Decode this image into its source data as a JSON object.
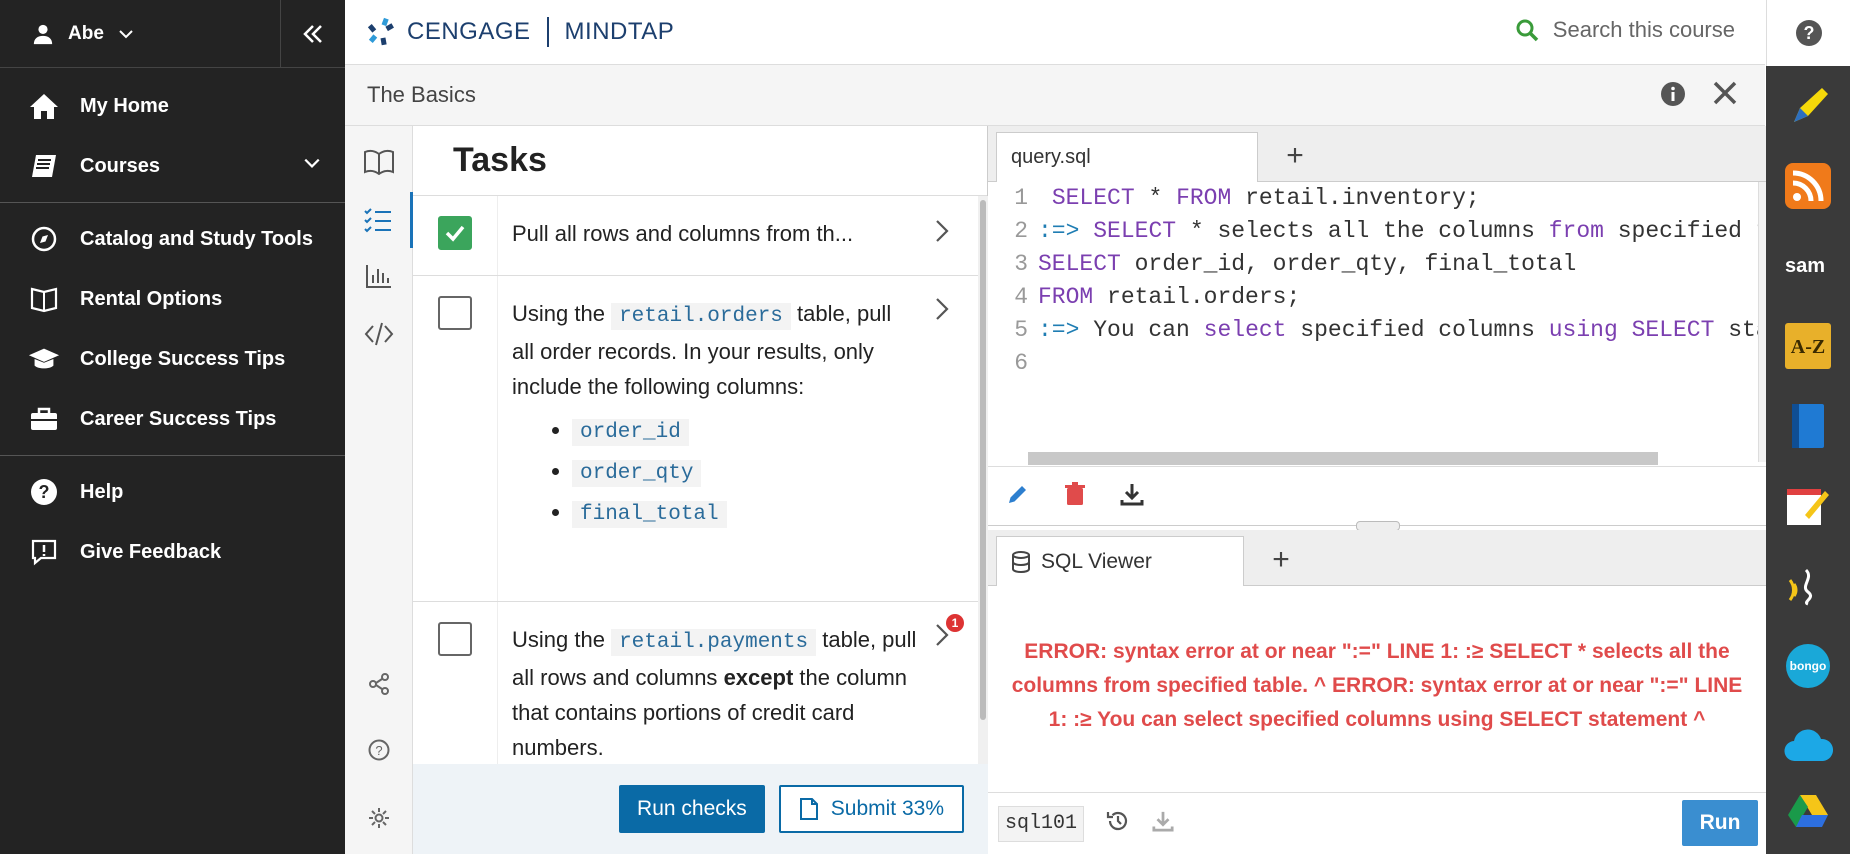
{
  "sidebar": {
    "user_name": "Abe",
    "items": [
      {
        "label": "My Home"
      },
      {
        "label": "Courses"
      },
      {
        "label": "Catalog and Study Tools"
      },
      {
        "label": "Rental Options"
      },
      {
        "label": "College Success Tips"
      },
      {
        "label": "Career Success Tips"
      },
      {
        "label": "Help"
      },
      {
        "label": "Give Feedback"
      }
    ]
  },
  "header": {
    "brand_left": "CENGAGE",
    "brand_right": "MINDTAP",
    "search_placeholder": "Search this course"
  },
  "activity": {
    "title": "The Basics"
  },
  "tasks": {
    "heading": "Tasks",
    "items": [
      {
        "text": "Pull all rows and columns from th...",
        "checked": true
      },
      {
        "prefix": "Using the",
        "table": "retail.orders",
        "suffix": "table, pull all order records. In your results, only include the following columns:",
        "columns": [
          "order_id",
          "order_qty",
          "final_total"
        ],
        "checked": false
      },
      {
        "prefix": "Using the",
        "table": "retail.payments",
        "suffix_a": "table, pull all rows and columns",
        "bold": "except",
        "suffix_b": "the column that contains portions of credit card numbers.",
        "badge": "1",
        "checked": false
      }
    ],
    "run_checks": "Run checks",
    "submit": "Submit 33%"
  },
  "editor": {
    "file_tab": "query.sql",
    "add_tab": "+",
    "line_numbers": [
      "1",
      "2",
      "3",
      "4",
      "5",
      "6"
    ],
    "lines": [
      [
        {
          "t": " "
        },
        {
          "t": "SELECT",
          "c": "kw"
        },
        {
          "t": " * "
        },
        {
          "t": "FROM",
          "c": "kw"
        },
        {
          "t": " retail.inventory;"
        }
      ],
      [
        {
          "t": ":=>",
          "c": "op"
        },
        {
          "t": " "
        },
        {
          "t": "SELECT",
          "c": "kw"
        },
        {
          "t": " * selects all the columns "
        },
        {
          "t": "from",
          "c": "kw"
        },
        {
          "t": " specified table"
        }
      ],
      [
        {
          "t": "SELECT",
          "c": "kw"
        },
        {
          "t": " order_id, order_qty, final_total"
        }
      ],
      [
        {
          "t": "FROM",
          "c": "kw"
        },
        {
          "t": " retail.orders;"
        }
      ],
      [
        {
          "t": ":=>",
          "c": "op"
        },
        {
          "t": " You can "
        },
        {
          "t": "select",
          "c": "kw"
        },
        {
          "t": " specified columns "
        },
        {
          "t": "using",
          "c": "kw"
        },
        {
          "t": " "
        },
        {
          "t": "SELECT",
          "c": "kw"
        },
        {
          "t": " statement"
        }
      ],
      []
    ]
  },
  "viewer": {
    "tab": "SQL Viewer",
    "add_tab": "+",
    "error": "ERROR: syntax error at or near \":=\" LINE 1: :≥ SELECT * selects all the columns from specified table. ^ ERROR: syntax error at or near \":=\" LINE 1: :≥ You can select specified columns using SELECT statement ^",
    "database": "sql101",
    "run": "Run"
  },
  "right_apps": [
    "highlighter-icon",
    "rss-icon",
    "sam-icon",
    "a-z-icon",
    "book-icon",
    "notes-icon",
    "readspeaker-icon",
    "bongo-icon",
    "cloud-icon",
    "drive-icon"
  ],
  "colors": {
    "sidebar_bg": "#232323",
    "primary": "#0a6aa6",
    "error": "#e04b4b",
    "keyword": "#7b3fb0",
    "check_green": "#3ba55c"
  }
}
